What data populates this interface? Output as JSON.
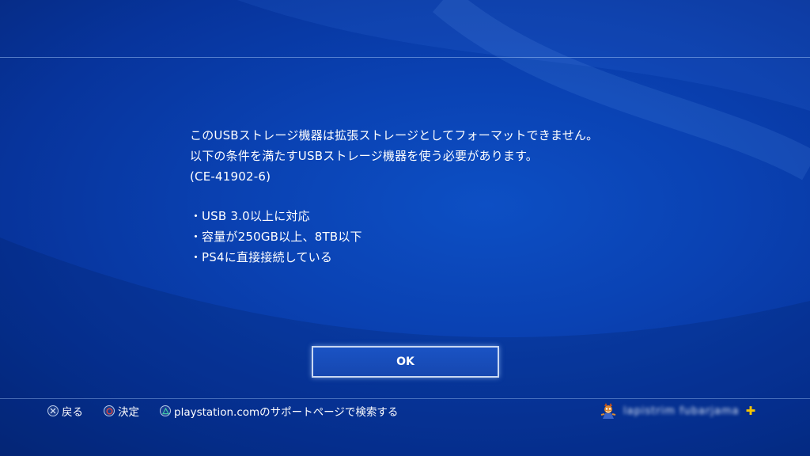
{
  "dialog": {
    "message_lines": [
      "このUSBストレージ機器は拡張ストレージとしてフォーマットできません。",
      "以下の条件を満たすUSBストレージ機器を使う必要があります。",
      "(CE-41902-6)"
    ],
    "bullet_char": "・",
    "requirements": [
      "USB 3.0以上に対応",
      "容量が250GB以上、8TB以下",
      "PS4に直接接続している"
    ],
    "ok_label": "OK"
  },
  "footer": {
    "back_label": "戻る",
    "confirm_label": "決定",
    "search_label": "playstation.comのサポートページで検索する",
    "back_icon": "cross-button-icon",
    "confirm_icon": "circle-button-icon",
    "search_icon": "triangle-button-icon"
  },
  "user": {
    "name": "lapistrim fubarjama",
    "avatar_icon": "crash-bandicoot-avatar",
    "plus_badge": "✚",
    "plus_color": "#f5c400"
  },
  "theme": {
    "background": "#0a42b3",
    "text_color": "#ffffff"
  }
}
